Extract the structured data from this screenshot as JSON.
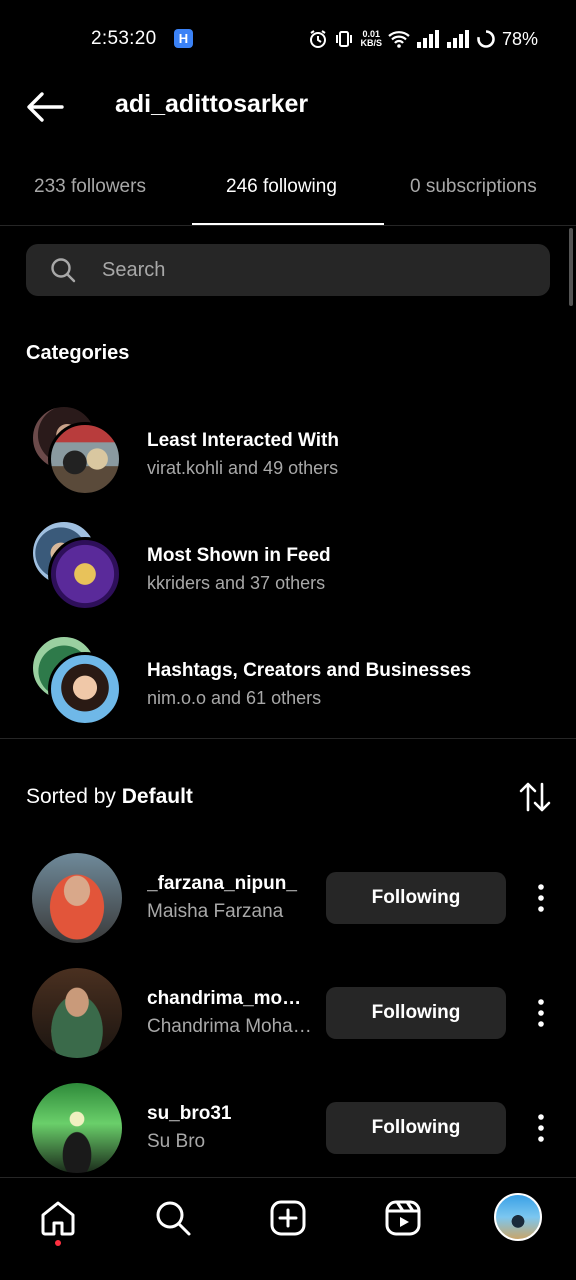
{
  "status_bar": {
    "time": "2:53:20",
    "app_badge": "H",
    "net_speed_top": "0.01",
    "net_speed_unit": "KB/S",
    "battery": "78%"
  },
  "header": {
    "title": "adi_adittosarker"
  },
  "tabs": [
    {
      "label": "233 followers"
    },
    {
      "label": "246 following"
    },
    {
      "label": "0 subscriptions"
    }
  ],
  "search": {
    "placeholder": "Search"
  },
  "categories": {
    "title": "Categories",
    "items": [
      {
        "title": "Least Interacted With",
        "subtitle": "virat.kohli and 49 others"
      },
      {
        "title": "Most Shown in Feed",
        "subtitle": "kkriders and 37 others"
      },
      {
        "title": "Hashtags, Creators and Businesses",
        "subtitle": "nim.o.o and 61 others"
      }
    ]
  },
  "sort": {
    "prefix": "Sorted by ",
    "value": "Default"
  },
  "users": [
    {
      "handle": "_farzana_nipun_",
      "name": "Maisha Farzana",
      "button": "Following"
    },
    {
      "handle": "chandrima_mohanta",
      "name": "Chandrima Mohanta",
      "button": "Following"
    },
    {
      "handle": "su_bro31",
      "name": "Su Bro",
      "button": "Following"
    }
  ],
  "bottom_nav": [
    "home-icon",
    "search-icon",
    "create-icon",
    "reels-icon",
    "profile-avatar"
  ],
  "colors": {
    "background": "#000000",
    "surface": "#262626",
    "secondary_text": "#a8a8a8",
    "notification_dot": "#ff3040"
  }
}
